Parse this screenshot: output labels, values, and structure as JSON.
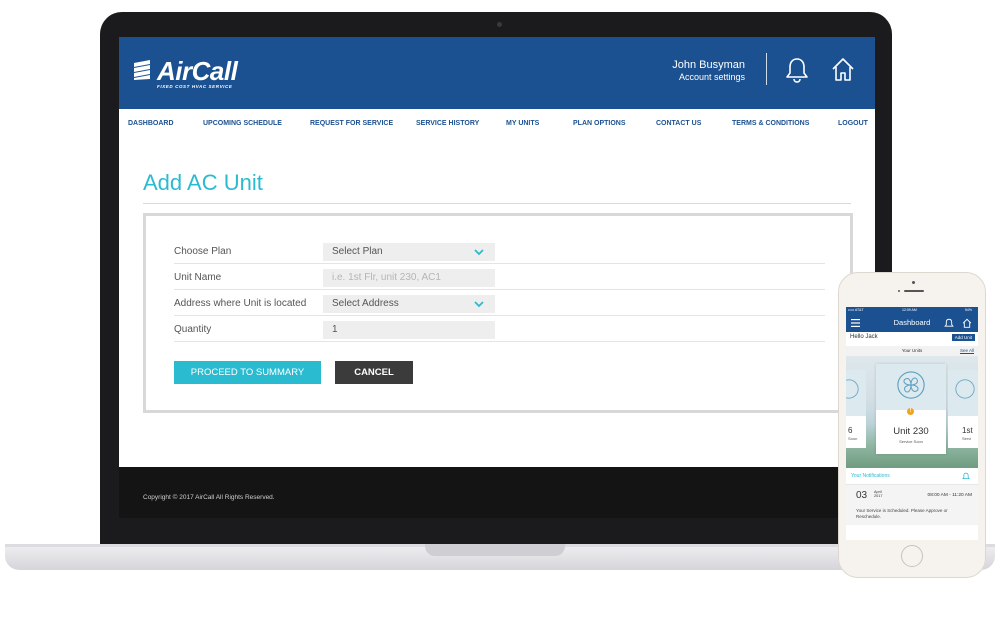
{
  "app": {
    "brand": "AirCall",
    "brand_tagline": "FIXED COST HVAC SERVICE",
    "brand_color": "#1b5191",
    "accent_color": "#2bbbd0"
  },
  "header": {
    "user_name": "John Busyman",
    "account_settings": "Account settings",
    "icons": [
      "bell-icon",
      "home-icon"
    ]
  },
  "nav": {
    "items": [
      {
        "label": "DASHBOARD"
      },
      {
        "label": "UPCOMING SCHEDULE"
      },
      {
        "label": "REQUEST FOR SERVICE"
      },
      {
        "label": "SERVICE HISTORY"
      },
      {
        "label": "MY UNITS"
      },
      {
        "label": "PLAN OPTIONS"
      },
      {
        "label": "CONTACT US"
      },
      {
        "label": "TERMS & CONDITIONS"
      },
      {
        "label": "LOGOUT"
      }
    ]
  },
  "page": {
    "title": "Add AC Unit"
  },
  "form": {
    "fields": [
      {
        "label": "Choose Plan",
        "value": "Select Plan",
        "type": "select"
      },
      {
        "label": "Unit Name",
        "placeholder": "i.e. 1st Flr, unit 230, AC1",
        "type": "text"
      },
      {
        "label": "Address where Unit is located",
        "value": "Select Address",
        "type": "select"
      },
      {
        "label": "Quantity",
        "value": "1",
        "type": "text"
      }
    ],
    "proceed_label": "PROCEED TO SUMMARY",
    "cancel_label": "CANCEL"
  },
  "footer": {
    "copyright": "Copyright © 2017 AirCall All Rights Reserved."
  },
  "phone": {
    "status_left": "••••• AT&T ",
    "status_time": "12:09 AM",
    "status_right": "54%",
    "title": "Dashboard",
    "greeting": "Hello Jack",
    "add_unit": "Add Unit",
    "your_units": "Your Units",
    "see_all": "See All",
    "cards": [
      {
        "name": "6",
        "sub": "Soon"
      },
      {
        "name": "Unit 230",
        "sub": "Service Soon"
      },
      {
        "name": "1st",
        "sub": "Servi"
      }
    ],
    "notifications_label": "Your Notifications",
    "notification": {
      "day": "03",
      "month": "April",
      "year": "2017",
      "time": "08:00 AM - 11:20 AM",
      "message": "Your Service is Scheduled. Please Approve or Reschedule."
    }
  }
}
